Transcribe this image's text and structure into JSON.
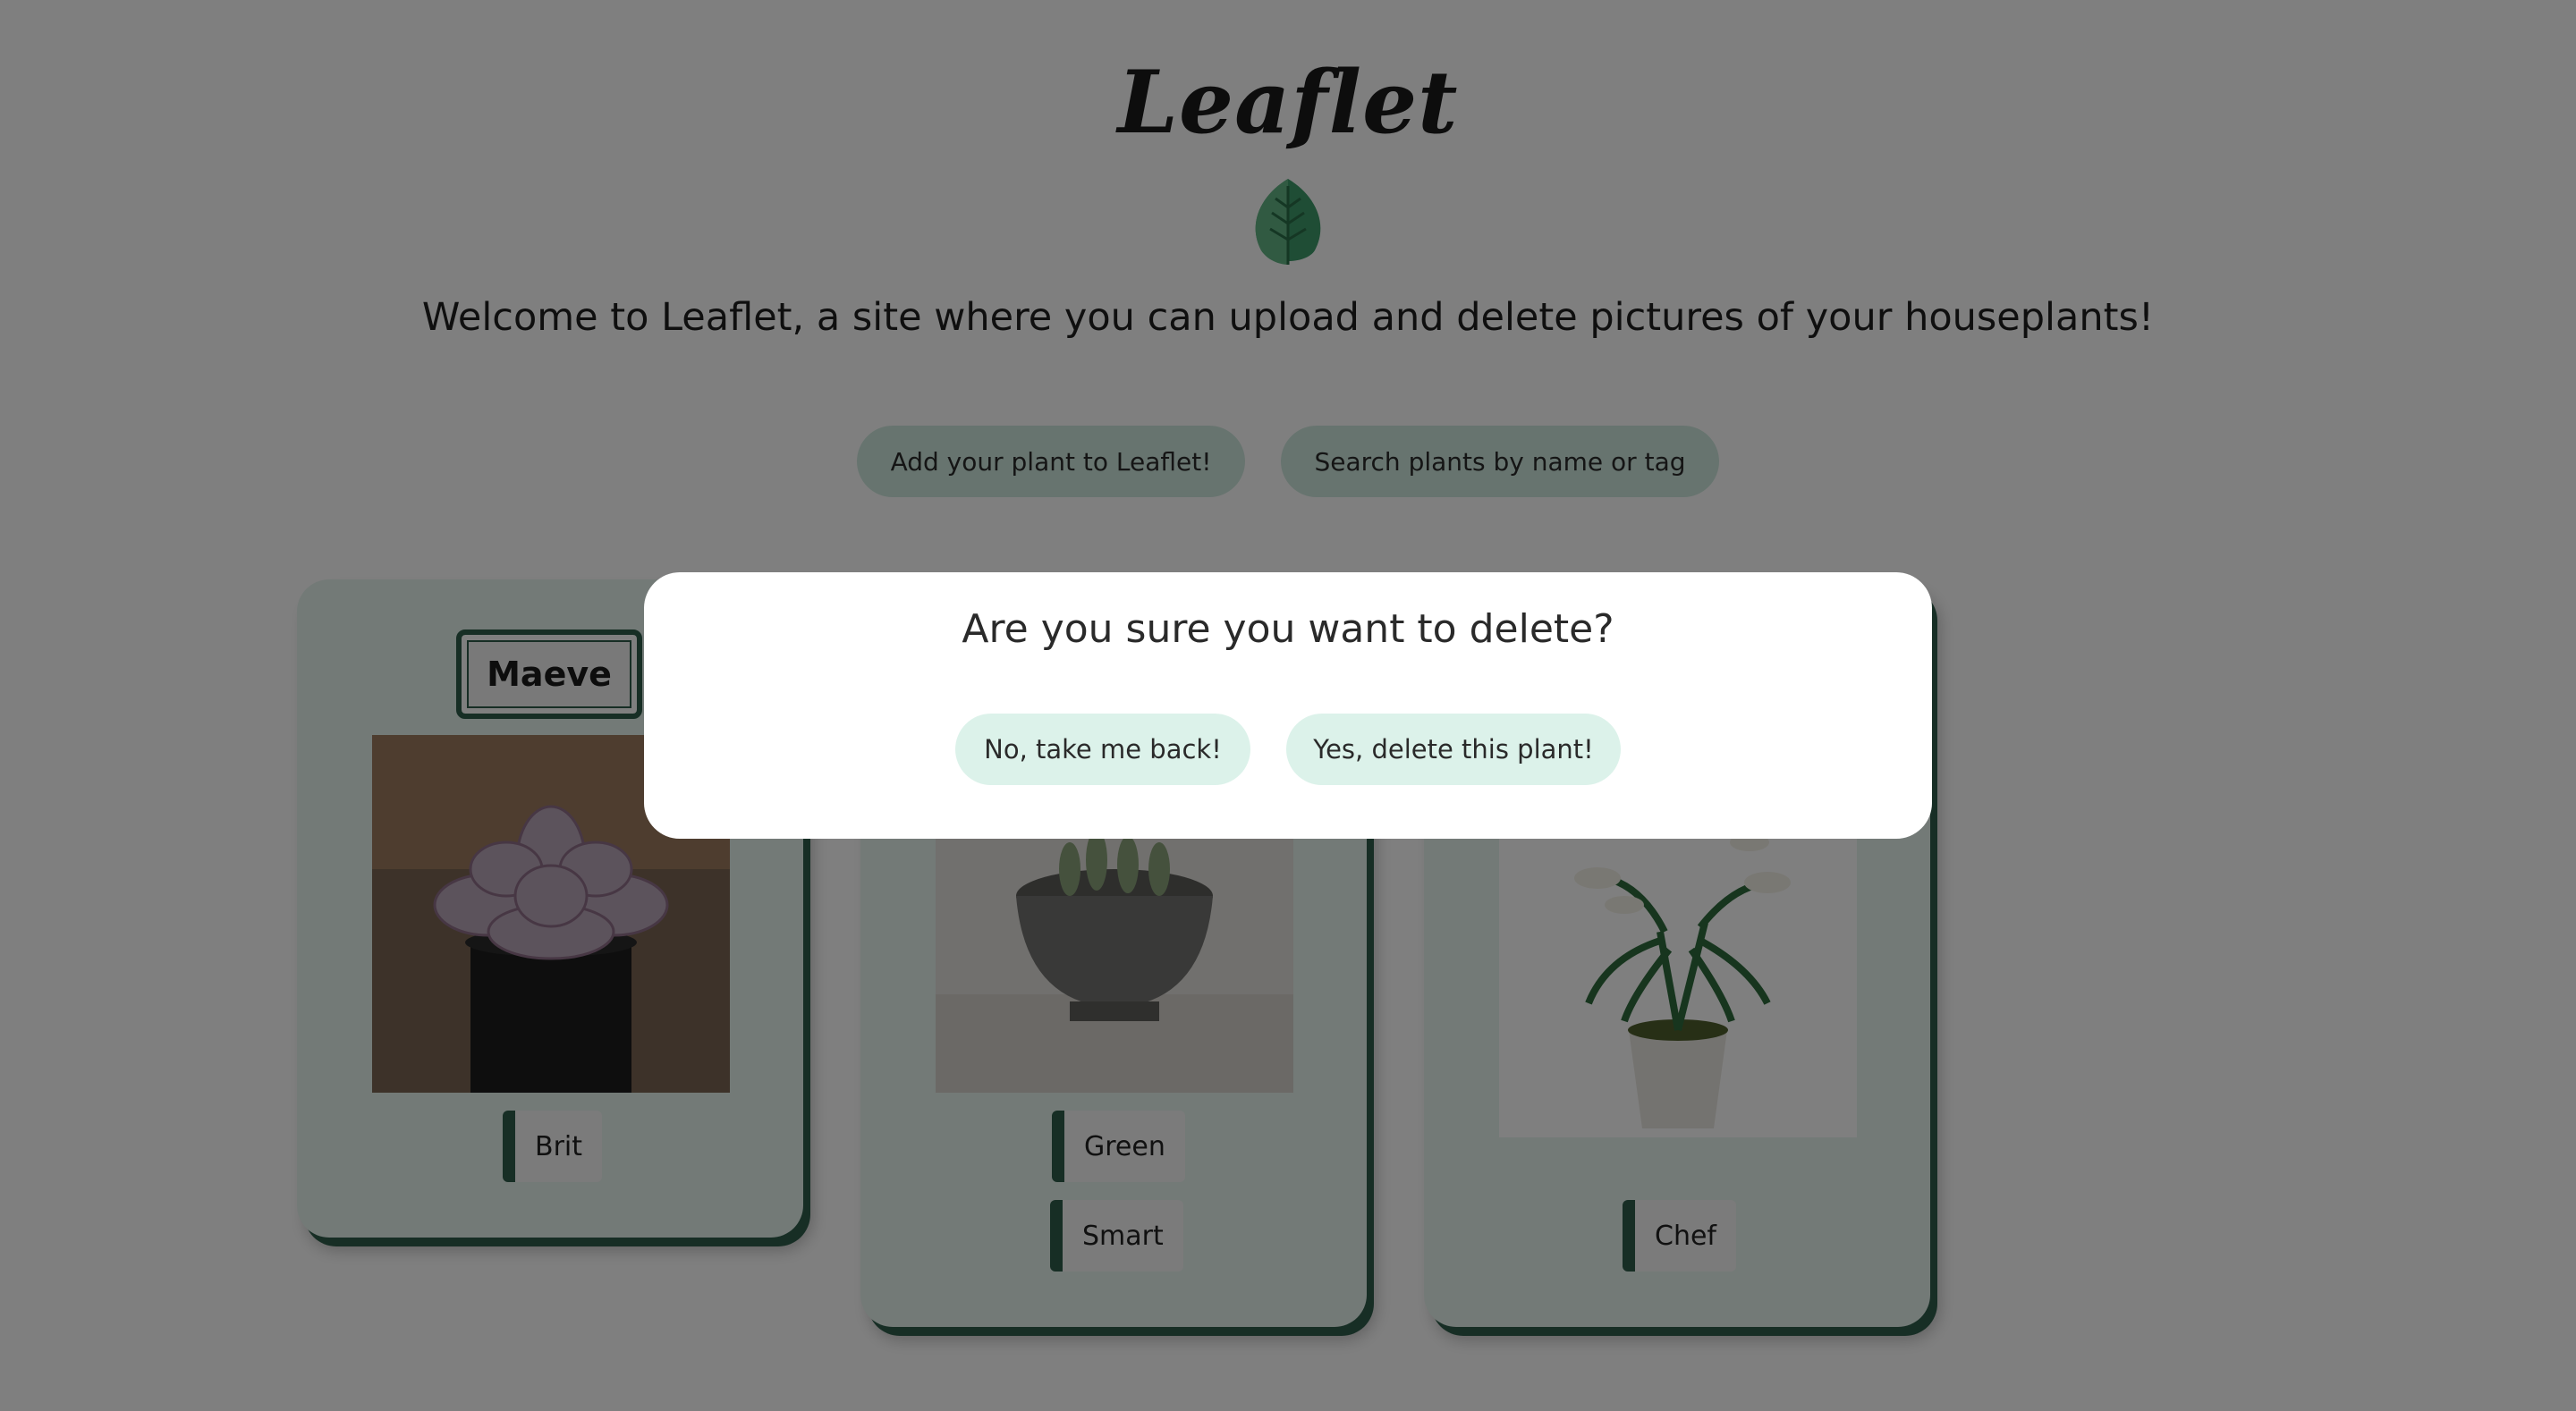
{
  "header": {
    "logo_text": "Leaflet",
    "welcome": "Welcome to Leaflet, a site where you can upload and delete pictures of your houseplants!"
  },
  "actions": {
    "add_label": "Add your plant to Leaflet!",
    "search_label": "Search plants by name or tag"
  },
  "cards": [
    {
      "name": "Maeve",
      "tags": [
        "Brit"
      ]
    },
    {
      "tags": [
        "Green",
        "Smart"
      ]
    },
    {
      "tags": [
        "Chef"
      ]
    }
  ],
  "modal": {
    "title": "Are you sure you want to delete?",
    "cancel_label": "No, take me back!",
    "confirm_label": "Yes, delete this plant!"
  },
  "colors": {
    "accent_dark": "#2f5d4b",
    "button_bg": "#cfe9df",
    "card_bg": "#e7f4ef",
    "overlay": "rgba(0,0,0,0.5)"
  }
}
